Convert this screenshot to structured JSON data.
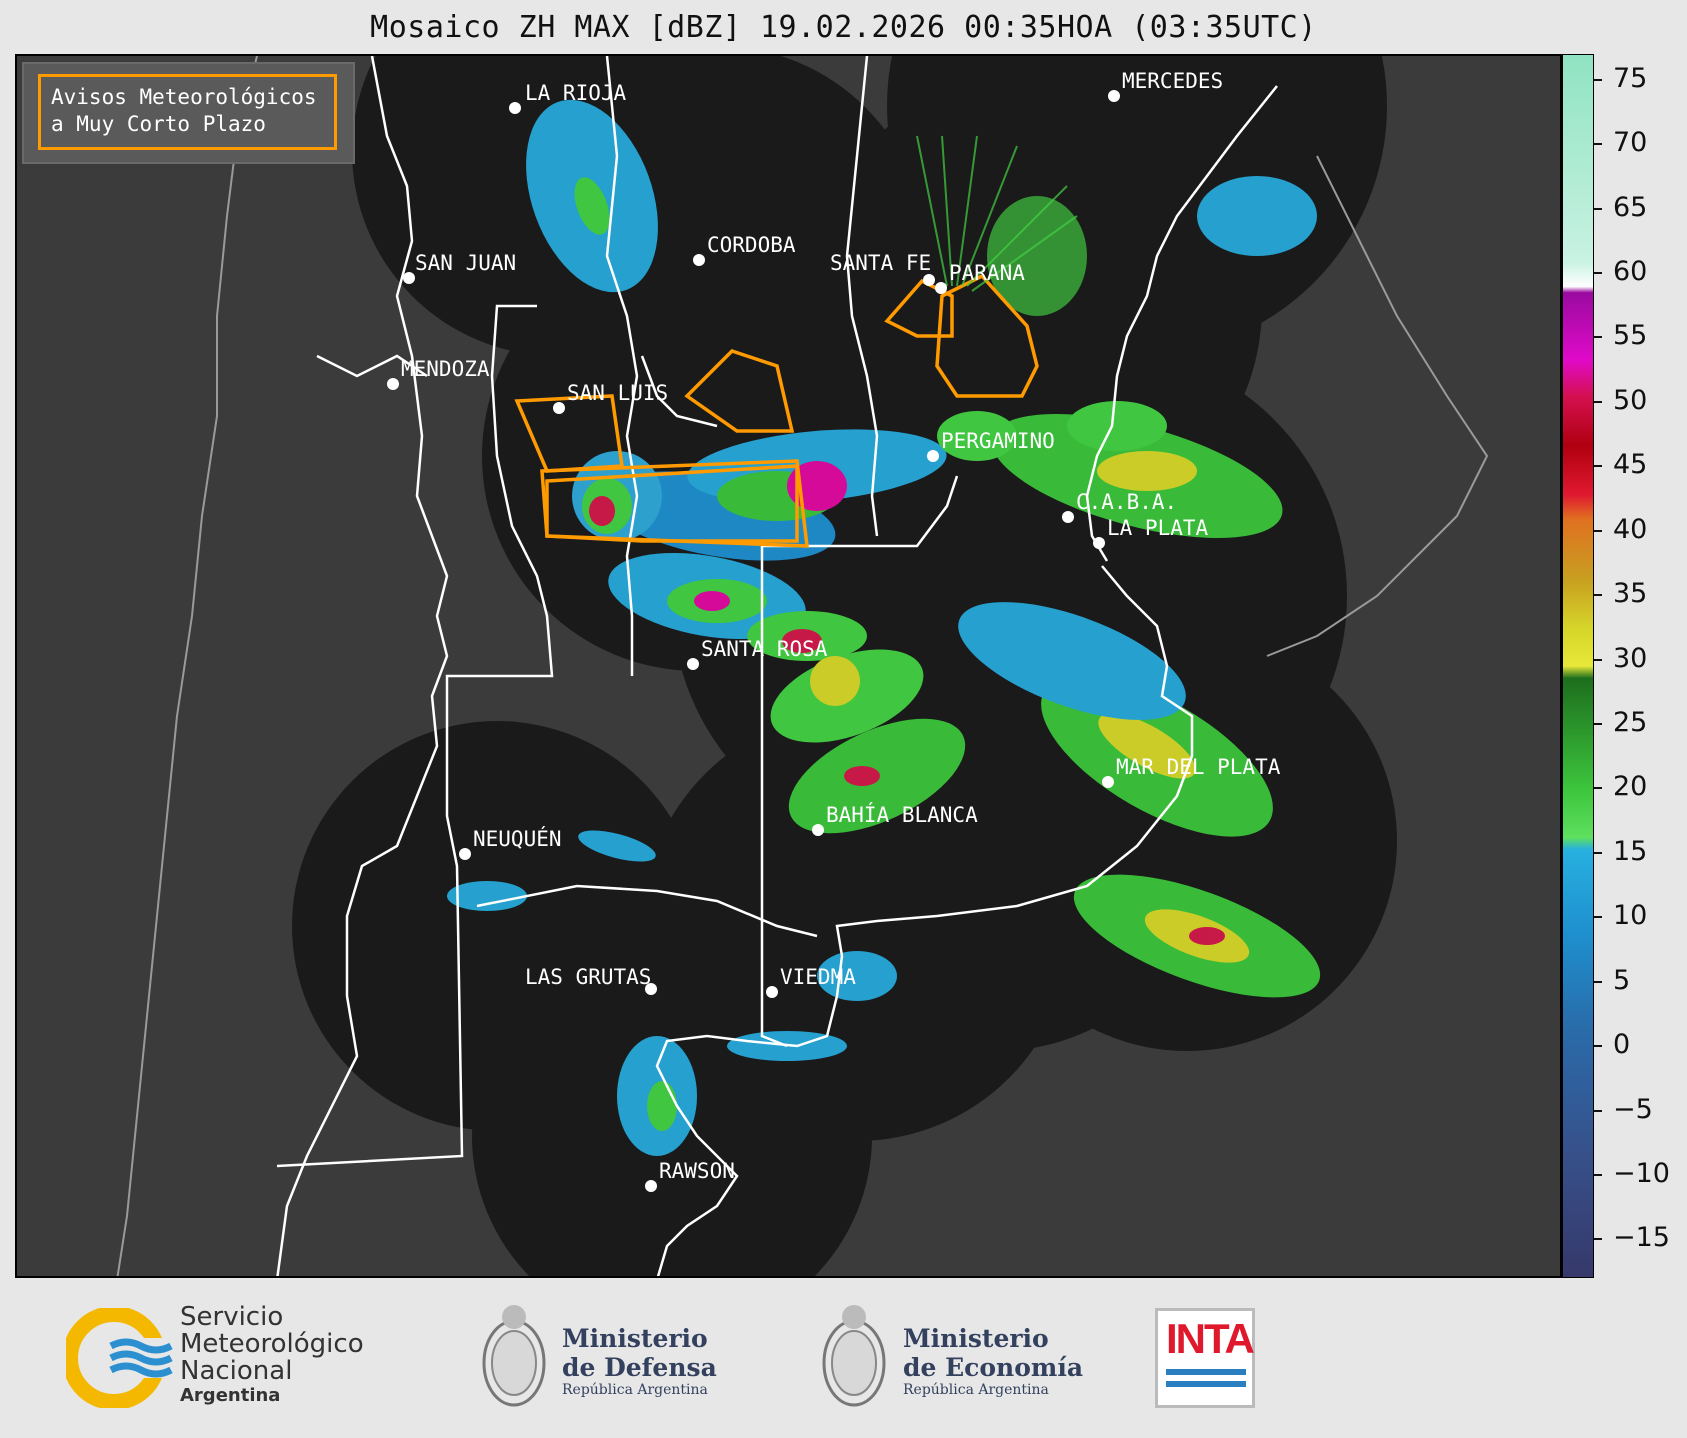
{
  "title": "Mosaico ZH MAX [dBZ] 19.02.2026 00:35HOA (03:35UTC)",
  "legend": {
    "line1": "Avisos Meteorológicos",
    "line2": "a Muy Corto Plazo",
    "color": "#ff9a00"
  },
  "colorbar": {
    "ticks": [
      "75",
      "70",
      "65",
      "60",
      "55",
      "50",
      "45",
      "40",
      "35",
      "30",
      "25",
      "20",
      "15",
      "10",
      "5",
      "0",
      "−5",
      "−10",
      "−15"
    ],
    "range": [
      -18,
      77
    ]
  },
  "cities": [
    {
      "name": "LA RIOJA"
    },
    {
      "name": "MERCEDES"
    },
    {
      "name": "SAN JUAN"
    },
    {
      "name": "CORDOBA"
    },
    {
      "name": "SANTA FE"
    },
    {
      "name": "PARANA"
    },
    {
      "name": "MENDOZA"
    },
    {
      "name": "SAN LUIS"
    },
    {
      "name": "PERGAMINO"
    },
    {
      "name": "C.A.B.A."
    },
    {
      "name": "LA PLATA"
    },
    {
      "name": "SANTA ROSA"
    },
    {
      "name": "MAR DEL PLATA"
    },
    {
      "name": "BAHÍA BLANCA"
    },
    {
      "name": "NEUQUÉN"
    },
    {
      "name": "LAS GRUTAS"
    },
    {
      "name": "VIEDMA"
    },
    {
      "name": "RAWSON"
    }
  ],
  "footer": {
    "smn_line1": "Servicio",
    "smn_line2": "Meteorológico",
    "smn_line3": "Nacional",
    "smn_line4": "Argentina",
    "defensa_line1": "Ministerio",
    "defensa_line2": "de Defensa",
    "defensa_line3": "República Argentina",
    "economia_line1": "Ministerio",
    "economia_line2": "de Economía",
    "economia_line3": "República Argentina",
    "inta": "INTA"
  }
}
